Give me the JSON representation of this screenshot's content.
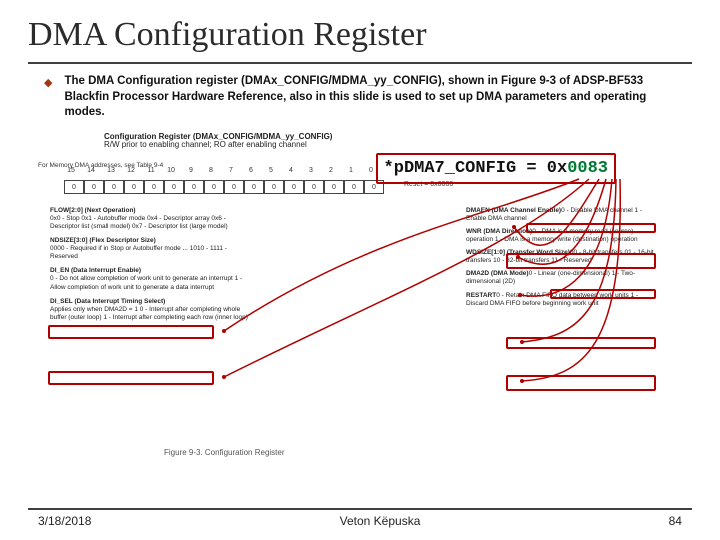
{
  "title": "DMA Configuration Register",
  "bullet": "The DMA Configuration register (DMAx_CONFIG/MDMA_yy_CONFIG), shown in Figure 9-3 of ADSP-BF533 Blackfin Processor Hardware Reference, also in this slide is used to set up DMA parameters and operating modes.",
  "diagram": {
    "header": "Configuration Register (DMAx_CONFIG/MDMA_yy_CONFIG)",
    "sub": "R/W prior to enabling channel; RO after enabling channel",
    "bits": [
      "15",
      "14",
      "13",
      "12",
      "11",
      "10",
      "9",
      "8",
      "7",
      "6",
      "5",
      "4",
      "3",
      "2",
      "1",
      "0"
    ],
    "boxes": [
      "0",
      "0",
      "0",
      "0",
      "0",
      "0",
      "0",
      "0",
      "0",
      "0",
      "0",
      "0",
      "0",
      "0",
      "0",
      "0"
    ],
    "reset": "Reset = 0x0000",
    "memnote": "For Memory DMA addresses, see Table 9-4",
    "left": [
      {
        "t": "FLOW[2:0] (Next Operation)",
        "d": "0x0 - Stop\n0x1 - Autobuffer mode\n0x4 - Descriptor array\n0x6 - Descriptor list (small model)\n0x7 - Descriptor list (large model)"
      },
      {
        "t": "NDSIZE[3:0] (Flex Descriptor Size)",
        "d": "0000 - Required if in Stop or Autobuffer mode\n...\n1010 - 1111 - Reserved"
      },
      {
        "t": "DI_EN (Data Interrupt Enable)",
        "d": "0 - Do not allow completion of work unit to generate an interrupt\n1 - Allow completion of work unit to generate a data interrupt"
      },
      {
        "t": "DI_SEL (Data Interrupt Timing Select)",
        "d": "Applies only when DMA2D = 1\n0 - Interrupt after completing whole buffer (outer loop)\n1 - Interrupt after completing each row (inner loop)"
      }
    ],
    "right": [
      {
        "t": "DMAEN (DMA Channel Enable)",
        "d": "0 - Disable DMA channel\n1 - Enable DMA channel"
      },
      {
        "t": "WNR (DMA Direction)",
        "d": "0 - DMA is a memory read (source) operation\n1 - DMA is a memory write (destination) operation"
      },
      {
        "t": "WDSIZE[1:0] (Transfer Word Size)",
        "d": "00 - 8-bit transfers\n01 - 16-bit transfers\n10 - 32-bit transfers\n11 - Reserved"
      },
      {
        "t": "DMA2D (DMA Mode)",
        "d": "0 - Linear (one-dimensional)\n1 - Two-dimensional (2D)"
      },
      {
        "t": "RESTART",
        "d": "0 - Retain DMA FIFO data between work units\n1 - Discard DMA FIFO before beginning work unit"
      }
    ],
    "figcap": "Figure 9-3. Configuration Register"
  },
  "code": {
    "pre": "*pDMA7_CONFIG = 0x",
    "num": "0083"
  },
  "footer": {
    "date": "3/18/2018",
    "author": "Veton Këpuska",
    "page": "84"
  }
}
